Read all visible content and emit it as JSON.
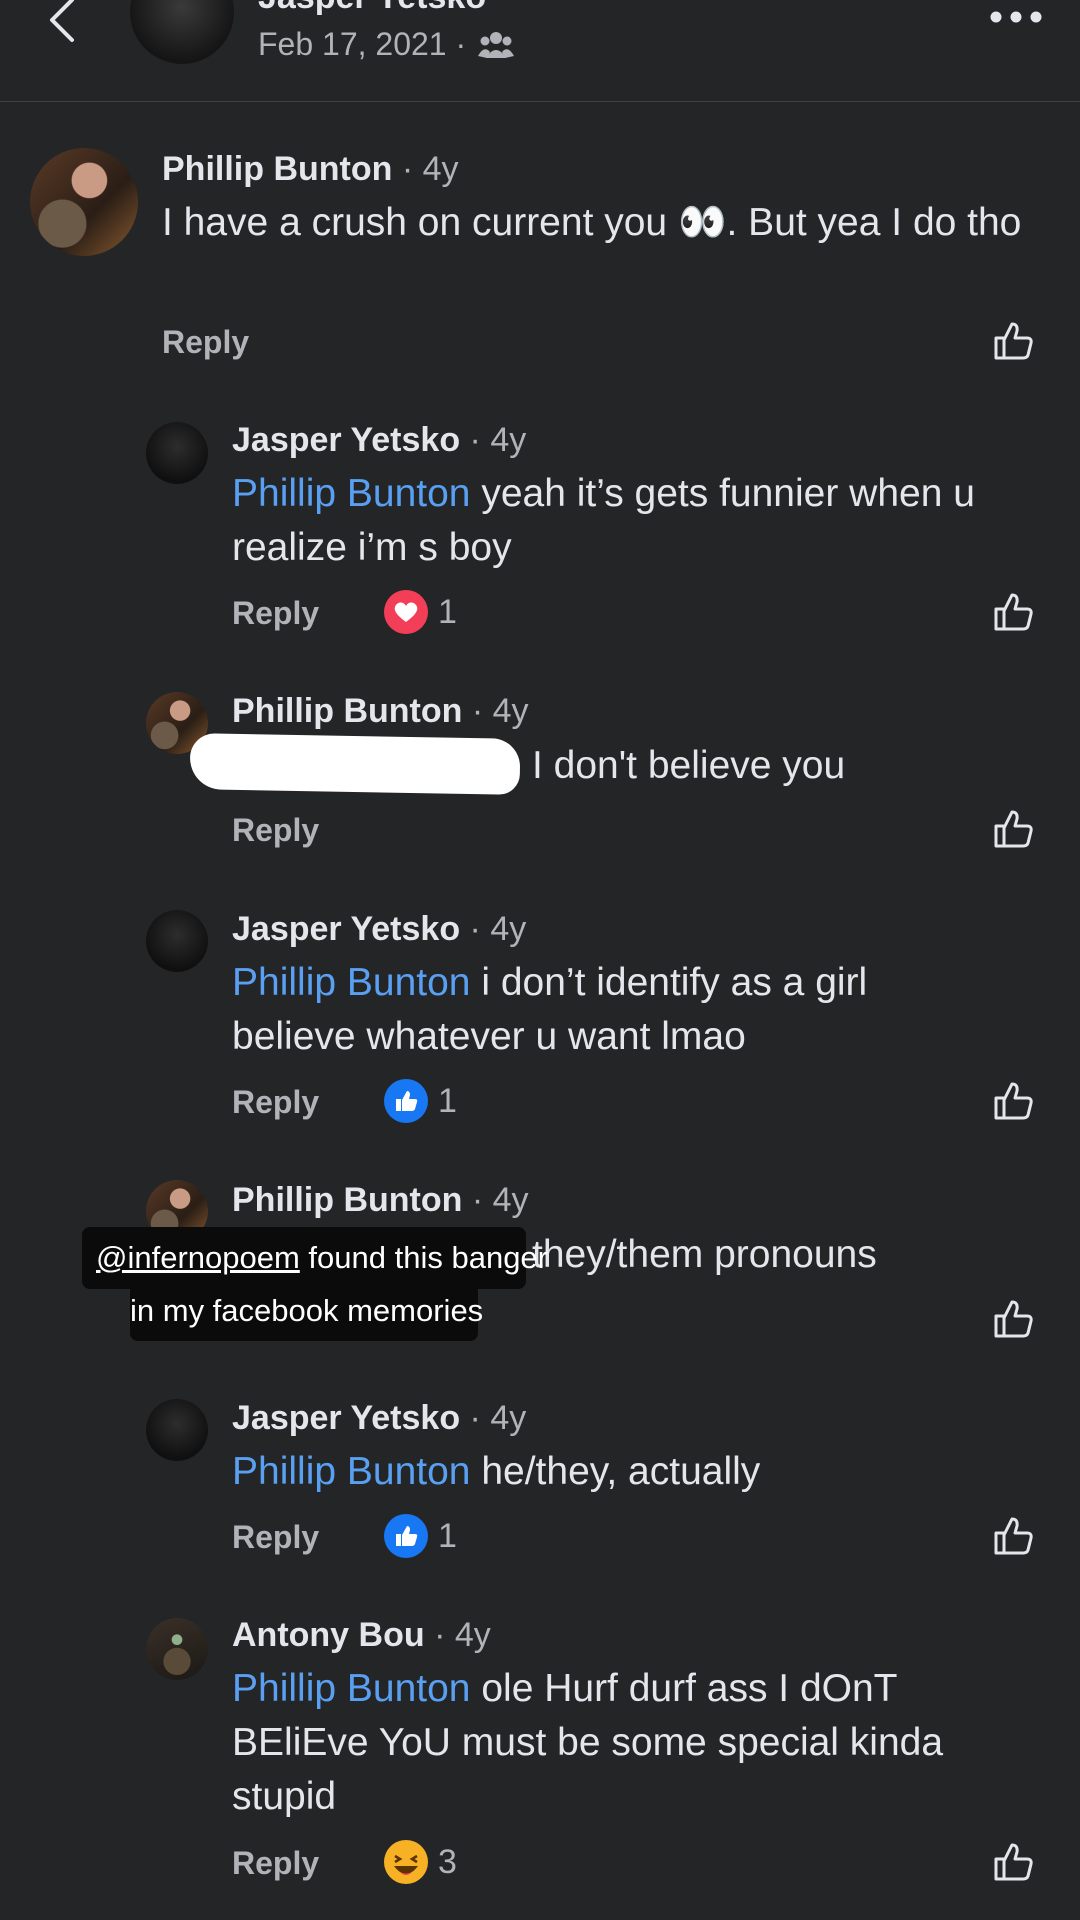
{
  "header": {
    "name": "Jasper Yetsko",
    "date": "Feb 17, 2021 ·",
    "audience_icon": "friends-icon",
    "back_icon": "chevron-left-icon",
    "more_icon": "more-dots-icon"
  },
  "comments": [
    {
      "author": "Phillip Bunton",
      "time": "· 4y",
      "mention": "",
      "text": "I have a crush on current you 👀. But yea I do tho",
      "reply": "Reply",
      "reaction": null
    },
    {
      "author": "Jasper Yetsko",
      "time": "· 4y",
      "mention": "Phillip Bunton",
      "text": " yeah it’s gets funnier when u realize i’m s boy",
      "reply": "Reply",
      "reaction": {
        "icon": "heart-reaction-icon",
        "count": "1"
      }
    },
    {
      "author": "Phillip Bunton",
      "time": "· 4y",
      "mention": "",
      "text": "I don't believe you",
      "reply": "Reply",
      "reaction": null
    },
    {
      "author": "Jasper Yetsko",
      "time": "· 4y",
      "mention": "Phillip Bunton",
      "text": " i don’t identify as a girl believe whatever u want lmao",
      "reply": "Reply",
      "reaction": {
        "icon": "like-reaction-icon",
        "count": "1"
      }
    },
    {
      "author": "Phillip Bunton",
      "time": "· 4y",
      "mention": "",
      "text": "they/them pronouns",
      "reply": "",
      "reaction": null
    },
    {
      "author": "Jasper Yetsko",
      "time": "· 4y",
      "mention": "Phillip Bunton",
      "text": " he/they, actually",
      "reply": "Reply",
      "reaction": {
        "icon": "like-reaction-icon",
        "count": "1"
      }
    },
    {
      "author": "Antony Bou",
      "time": "· 4y",
      "mention": "Phillip Bunton",
      "text": " ole Hurf durf ass I dOnT BEliEve YoU must be some special kinda stupid",
      "reply": "Reply",
      "reaction": {
        "icon": "haha-reaction-icon",
        "count": "3"
      }
    }
  ],
  "sticker": {
    "handle": "@infernopoem",
    "line1_rest": " found this banger",
    "line2": "in my facebook memories"
  },
  "colors": {
    "background": "#242526",
    "mention": "#5aa0f2",
    "like_blue": "#1877f2",
    "heart_red": "#f33e58",
    "haha_yellow": "#f7b125"
  }
}
